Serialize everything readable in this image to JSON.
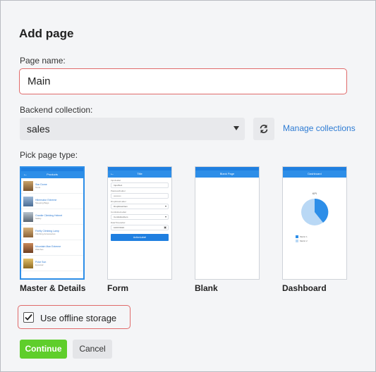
{
  "dialog": {
    "title": "Add page",
    "page_name_label": "Page name:",
    "page_name_value": "Main",
    "backend_label": "Backend collection:",
    "backend_value": "sales",
    "manage_link": "Manage collections",
    "page_type_label": "Pick page type:",
    "offline_label": "Use offline storage",
    "offline_checked": true,
    "continue_label": "Continue",
    "cancel_label": "Cancel"
  },
  "page_types": [
    {
      "label": "Master & Details",
      "selected": true
    },
    {
      "label": "Form",
      "selected": false
    },
    {
      "label": "Blank",
      "selected": false
    },
    {
      "label": "Dashboard",
      "selected": false
    }
  ],
  "thumb_master": {
    "nav_title": "Products",
    "items": [
      {
        "name": "Star Dome",
        "category": "Tents"
      },
      {
        "name": "Hibernator Extreme",
        "category": "Sleeping Bags"
      },
      {
        "name": "Granite Climbing Helmet",
        "category": "Safety"
      },
      {
        "name": "Firefly Climbing Lamp",
        "category": "Climbing Accessories"
      },
      {
        "name": "Mountain Man Extreme",
        "category": "Watches"
      },
      {
        "name": "Polar Sun",
        "category": "Eyewear"
      }
    ]
  },
  "thumb_form": {
    "nav_title": "Title",
    "fields": [
      {
        "label": "InputLabel",
        "value": "InputText"
      },
      {
        "label": "PasswordLabel",
        "value": "••••••••••"
      },
      {
        "label": "DropDownLabel",
        "value": "DropDownItem"
      },
      {
        "label": "ComboboxLabel",
        "value": "ComboboxItem"
      },
      {
        "label": "DateTimeLabel",
        "value": "10/07/2016"
      }
    ],
    "action_label": "ActionLabel"
  },
  "thumb_blank": {
    "nav_title": "Blank Page"
  },
  "thumb_dashboard": {
    "nav_title": "Dashboard",
    "chart_label": "KPI",
    "legend": [
      "Metric 1",
      "Metric 2"
    ]
  },
  "colors": {
    "accent": "#2d8ee8",
    "error_border": "#e06a6a",
    "continue": "#5fce2b",
    "link": "#2d7bd3"
  }
}
